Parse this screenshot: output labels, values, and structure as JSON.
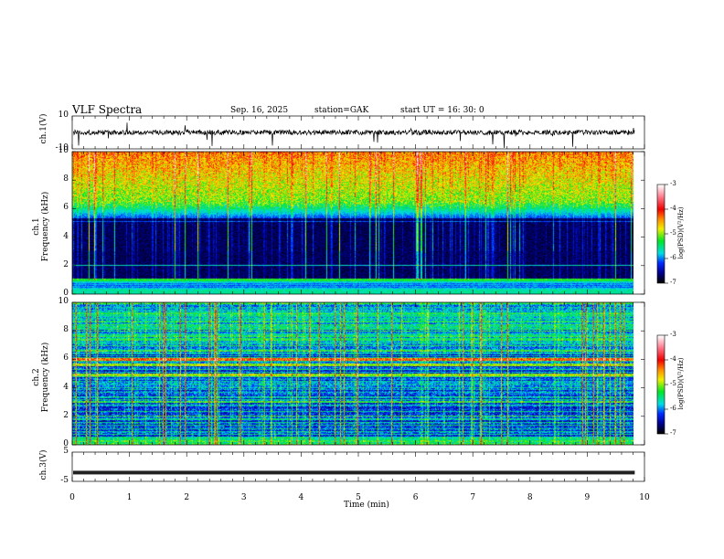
{
  "header": {
    "title": "VLF  Spectra",
    "date": "Sep. 16, 2025",
    "station": "station=GAK",
    "start": "start  UT  =    16: 30: 0"
  },
  "chart_data": [
    {
      "type": "line",
      "name": "ch1 waveform",
      "ylabel": "ch.1(V)",
      "ylim": [
        -10,
        10
      ],
      "yticks": [
        "10",
        "-10"
      ],
      "description_values": {
        "baseline": 0,
        "noise_amplitude": 1.5,
        "spike_max": 8
      }
    },
    {
      "type": "heatmap",
      "name": "ch1 spectrogram",
      "ylabel": "ch.1\nFrequency  (kHz)",
      "ylabel_line1": "ch.1",
      "ylabel_line2": "Frequency  (kHz)",
      "ylim": [
        0,
        10
      ],
      "yticks": [
        "0",
        "2",
        "4",
        "6",
        "8",
        "10"
      ],
      "colorbar": {
        "label": "log(PSD)(V²/Hz)",
        "range": [
          -7,
          -3
        ],
        "ticks": [
          "-3",
          "-4",
          "-5",
          "-6",
          "-7"
        ]
      }
    },
    {
      "type": "heatmap",
      "name": "ch2 spectrogram",
      "ylabel_line1": "ch.2",
      "ylabel_line2": "Frequency  (kHz)",
      "ylim": [
        0,
        10
      ],
      "yticks": [
        "0",
        "2",
        "4",
        "6",
        "8",
        "10"
      ],
      "bands_khz": [
        6.0,
        5.0,
        2.0
      ],
      "colorbar": {
        "label": "log(PSD)(V²/Hz)",
        "range": [
          -7,
          -3
        ],
        "ticks": [
          "-3",
          "-4",
          "-5",
          "-6",
          "-7"
        ]
      }
    },
    {
      "type": "line",
      "name": "ch3 waveform",
      "ylabel": "ch.3(V)",
      "ylim": [
        -5,
        5
      ],
      "yticks": [
        "5",
        "-5"
      ],
      "level": -2
    }
  ],
  "xaxis": {
    "label": "Time  (min)",
    "range": [
      0,
      10
    ],
    "data_end": 9.83,
    "ticks": [
      "0",
      "1",
      "2",
      "3",
      "4",
      "5",
      "6",
      "7",
      "8",
      "9",
      "10"
    ]
  }
}
